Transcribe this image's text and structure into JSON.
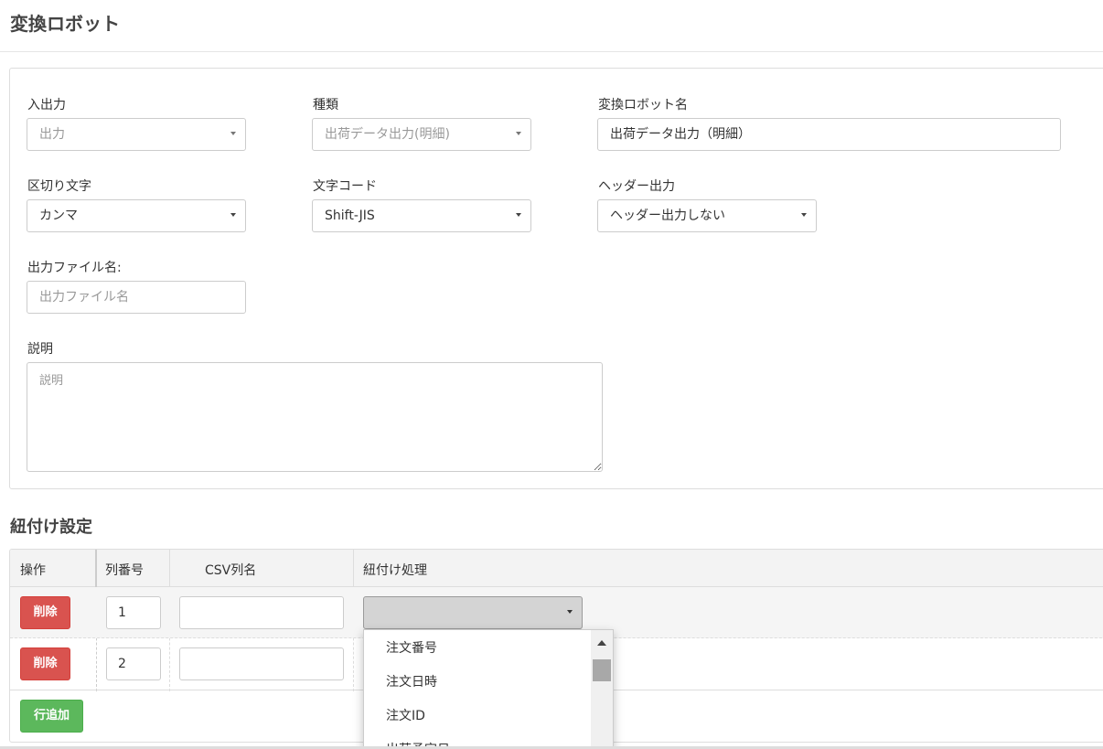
{
  "page": {
    "title": "変換ロボット"
  },
  "form": {
    "io": {
      "label": "入出力",
      "value": "出力"
    },
    "kind": {
      "label": "種類",
      "value": "出荷データ出力(明細)"
    },
    "robot_name": {
      "label": "変換ロボット名",
      "value": "出荷データ出力（明細）"
    },
    "delimiter": {
      "label": "区切り文字",
      "value": "カンマ"
    },
    "charset": {
      "label": "文字コード",
      "value": "Shift-JIS"
    },
    "header_output": {
      "label": "ヘッダー出力",
      "value": "ヘッダー出力しない"
    },
    "filename": {
      "label": "出力ファイル名:",
      "placeholder": "出力ファイル名"
    },
    "description": {
      "label": "説明",
      "placeholder": "説明"
    }
  },
  "mapping": {
    "title": "紐付け設定",
    "columns": [
      "操作",
      "列番号",
      "CSV列名",
      "紐付け処理"
    ],
    "rows": [
      {
        "delete_label": "削除",
        "column_number": "1"
      },
      {
        "delete_label": "削除",
        "column_number": "2"
      }
    ],
    "add_row_label": "行追加",
    "dropdown_options": [
      "注文番号",
      "注文日時",
      "注文ID",
      "出荷予定日"
    ]
  },
  "colors": {
    "danger": "#d9534f",
    "success": "#5cb85c"
  }
}
